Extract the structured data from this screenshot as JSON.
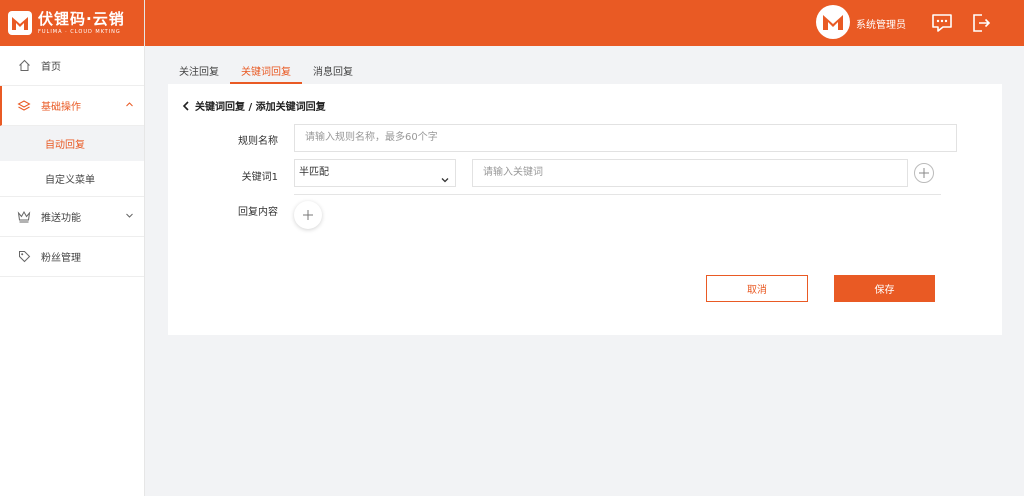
{
  "brand": {
    "name": "伏锂码·云销",
    "subtitle": "FULIMA · CLOUD MKTING",
    "accent_color": "#e95a24"
  },
  "header": {
    "user_name": "系统管理员",
    "icons": [
      "message-icon",
      "logout-icon"
    ]
  },
  "sidebar": {
    "items": [
      {
        "label": "首页",
        "icon": "home-icon"
      },
      {
        "label": "基础操作",
        "icon": "layers-icon",
        "expanded": true,
        "children": [
          {
            "label": "自动回复",
            "active": true
          },
          {
            "label": "自定义菜单"
          }
        ]
      },
      {
        "label": "推送功能",
        "icon": "crown-icon",
        "expanded": false
      },
      {
        "label": "粉丝管理",
        "icon": "tag-icon"
      }
    ]
  },
  "tabs": [
    {
      "label": "关注回复"
    },
    {
      "label": "关键词回复",
      "active": true
    },
    {
      "label": "消息回复"
    }
  ],
  "form": {
    "breadcrumb": "关键词回复 / 添加关键词回复",
    "rule_name_label": "规则名称",
    "rule_name_placeholder": "请输入规则名称，最多60个字",
    "keyword_label": "关键词1",
    "match_mode": "半匹配",
    "keyword_placeholder": "请输入关键词",
    "reply_content_label": "回复内容",
    "cancel_label": "取消",
    "save_label": "保存"
  }
}
